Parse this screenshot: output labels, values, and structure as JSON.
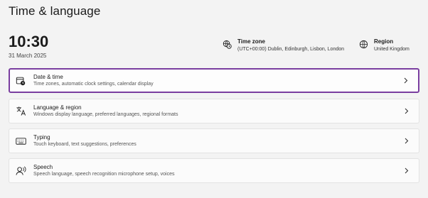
{
  "header": {
    "title": "Time & language"
  },
  "clock": {
    "time": "10:30",
    "date": "31 March 2025"
  },
  "timezone": {
    "title": "Time zone",
    "value": "(UTC+00:00) Dublin, Edinburgh, Lisbon, London",
    "icon": "globe-clock-icon"
  },
  "region": {
    "title": "Region",
    "value": "United Kingdom",
    "icon": "globe-icon"
  },
  "settings": [
    {
      "title": "Date & time",
      "subtitle": "Time zones, automatic clock settings, calendar display",
      "icon": "calendar-clock-icon",
      "selected": true
    },
    {
      "title": "Language & region",
      "subtitle": "Windows display language, preferred languages, regional formats",
      "icon": "language-icon",
      "selected": false
    },
    {
      "title": "Typing",
      "subtitle": "Touch keyboard, text suggestions, preferences",
      "icon": "keyboard-icon",
      "selected": false
    },
    {
      "title": "Speech",
      "subtitle": "Speech language, speech recognition microphone setup, voices",
      "icon": "speech-icon",
      "selected": false
    }
  ],
  "colors": {
    "selection_border": "#7a3ea0",
    "background": "#f3f3f3",
    "card": "#fbfbfb"
  }
}
